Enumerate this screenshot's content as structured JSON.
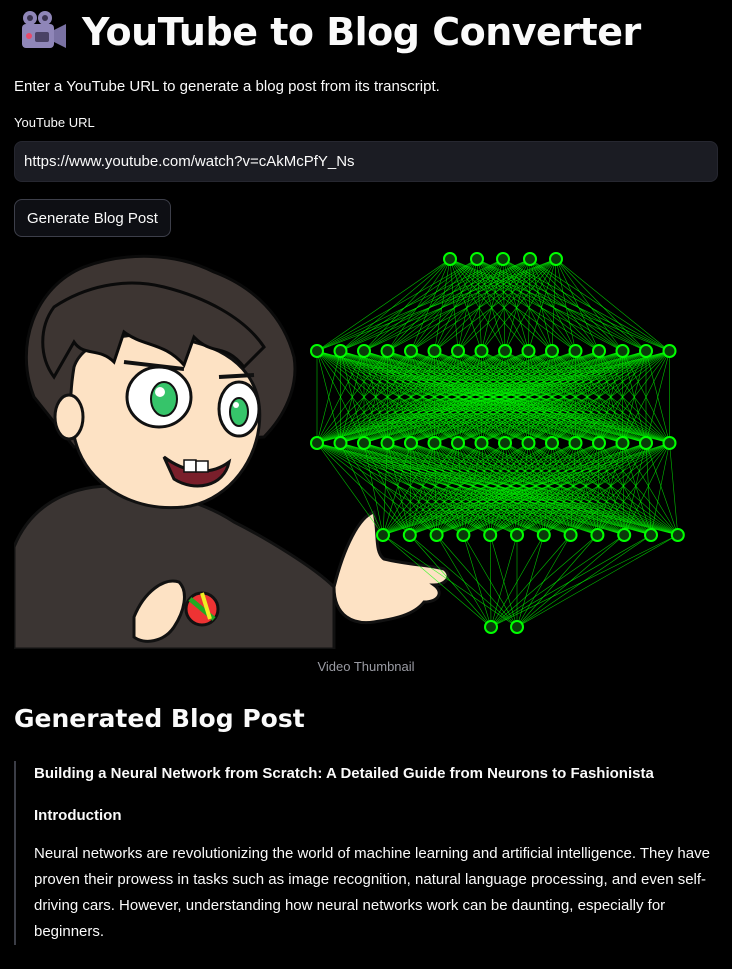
{
  "header": {
    "icon": "movie-camera-icon",
    "title": "YouTube to Blog Converter",
    "subtitle": "Enter a YouTube URL to generate a blog post from its transcript."
  },
  "form": {
    "url_label": "YouTube URL",
    "url_value": "https://www.youtube.com/watch?v=cAkMcPfY_Ns",
    "generate_label": "Generate Blog Post"
  },
  "thumbnail": {
    "caption": "Video Thumbnail",
    "accent_color": "#00ff00"
  },
  "output": {
    "heading": "Generated Blog Post",
    "post_title": "Building a Neural Network from Scratch: A Detailed Guide from Neurons to Fashionista",
    "section_title": "Introduction",
    "paragraph": "Neural networks are revolutionizing the world of machine learning and artificial intelligence. They have proven their prowess in tasks such as image recognition, natural language processing, and even self-driving cars. However, understanding how neural networks work can be daunting, especially for beginners."
  },
  "colors": {
    "background": "#000000",
    "text": "#fafafa",
    "input_bg": "#1b1c23",
    "muted": "#9a9ba3",
    "network": "#00ff00"
  }
}
